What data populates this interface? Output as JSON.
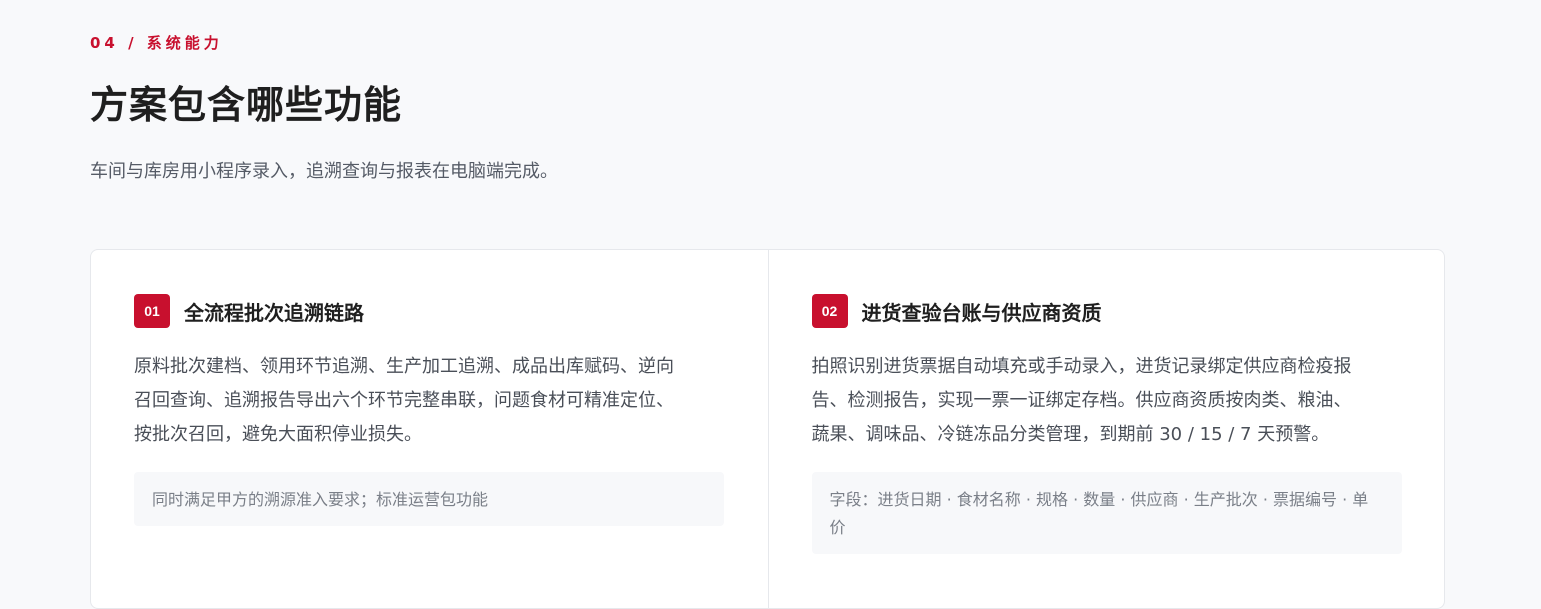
{
  "section": {
    "eyebrow": "04 / 系统能力",
    "title": "方案包含哪些功能",
    "subtitle": "车间与库房用小程序录入，追溯查询与报表在电脑端完成。"
  },
  "cards": [
    {
      "number": "01",
      "title": "全流程批次追溯链路",
      "body_lines": [
        "原料批次建档、领用环节追溯、生产加工追溯、成品出库赋码、逆向",
        "召回查询、追溯报告导出六个环节完整串联，问题食材可精准定位、",
        "按批次召回，避免大面积停业损失。"
      ],
      "note": "同时满足甲方的溯源准入要求；标准运营包功能"
    },
    {
      "number": "02",
      "title": "进货查验台账与供应商资质",
      "body_lines": [
        "拍照识别进货票据自动填充或手动录入，进货记录绑定供应商检疫报",
        "告、检测报告，实现一票一证绑定存档。供应商资质按肉类、粮油、",
        "蔬果、调味品、冷链冻品分类管理，到期前 30 / 15 / 7 天预警。"
      ],
      "note": "字段：进货日期 · 食材名称 · 规格 · 数量 · 供应商 · 生产批次 · 票据编号 · 单价"
    }
  ],
  "colors": {
    "accent": "#c8102e",
    "background": "#f8f9fb",
    "card_background": "#ffffff",
    "note_background": "#f7f8fa"
  }
}
